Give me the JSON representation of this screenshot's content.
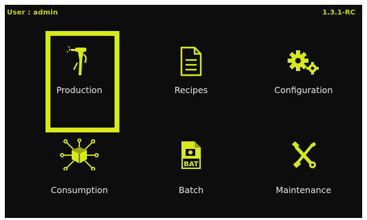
{
  "header": {
    "user": "User : admin",
    "version": "1.3.1-RC"
  },
  "menu": {
    "items": [
      {
        "label": "Production",
        "icon": "spray-gun-icon",
        "selected": true
      },
      {
        "label": "Recipes",
        "icon": "document-icon",
        "selected": false
      },
      {
        "label": "Configuration",
        "icon": "gears-icon",
        "selected": false
      },
      {
        "label": "Consumption",
        "icon": "network-box-icon",
        "selected": false
      },
      {
        "label": "Batch",
        "icon": "bat-file-icon",
        "selected": false
      },
      {
        "label": "Maintenance",
        "icon": "tools-icon",
        "selected": false
      }
    ]
  },
  "colors": {
    "accent": "#d7ea19",
    "header_text": "#c9d40b",
    "background": "#0c0c0c",
    "label_text": "#e6e6e6"
  }
}
